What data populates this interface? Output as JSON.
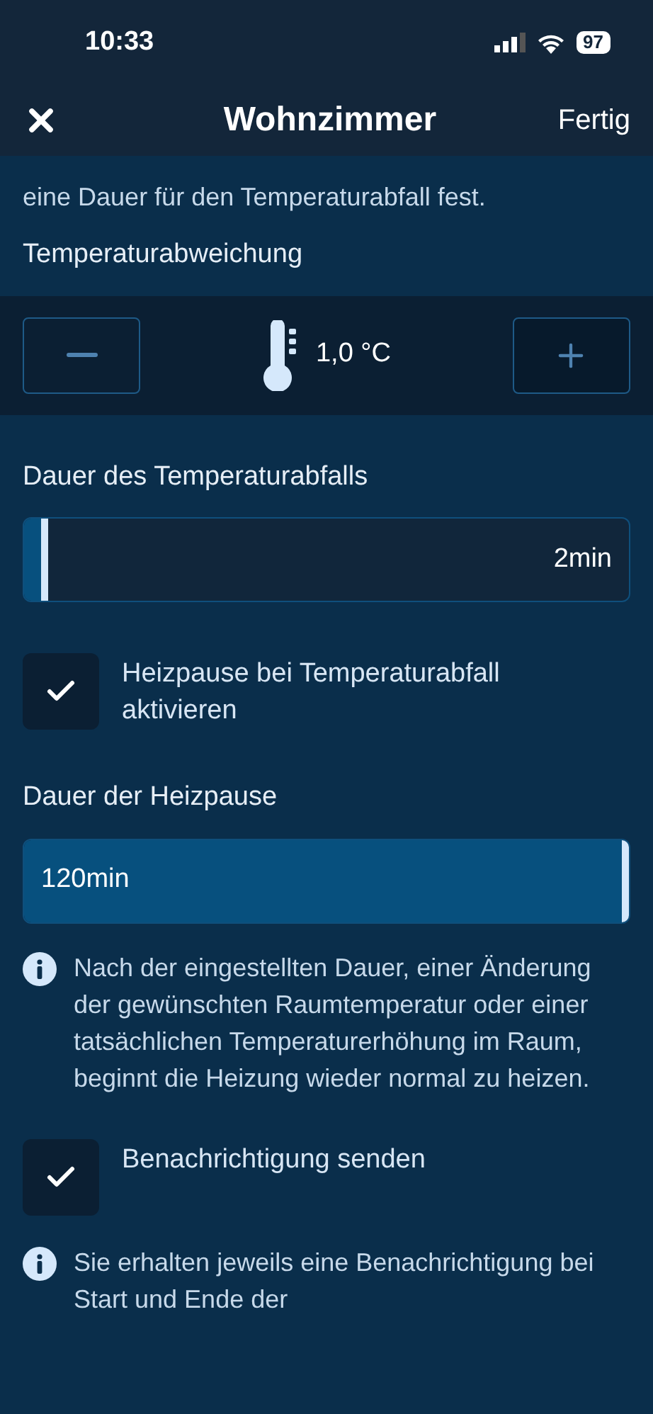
{
  "status_bar": {
    "time": "10:33",
    "battery": "97"
  },
  "header": {
    "title": "Wohnzimmer",
    "done": "Fertig"
  },
  "intro": "eine Dauer für den Temperaturabfall fest.",
  "deviation": {
    "label": "Temperaturabweichung",
    "value": "1,0 °C"
  },
  "drop_duration": {
    "label": "Dauer des Temperaturabfalls",
    "level": 0.04,
    "reading": "2min"
  },
  "pause_checkbox": {
    "label": "Heizpause bei Temperaturabfall aktivieren",
    "checked": true
  },
  "pause_duration": {
    "label": "Dauer der Heizpause",
    "level": 1,
    "reading": "120min"
  },
  "pause_info": "Nach der eingestellten Dauer, einer Änderung der gewünschten Raumtemperatur oder einer tatsächlichen Temperaturerhöhung im Raum, beginnt die Heizung wieder normal zu heizen.",
  "notify_checkbox": {
    "label": "Benachrichtigung senden",
    "checked": true
  },
  "notify_info": "Sie erhalten jeweils eine Benachrichtigung bei Start und Ende der"
}
